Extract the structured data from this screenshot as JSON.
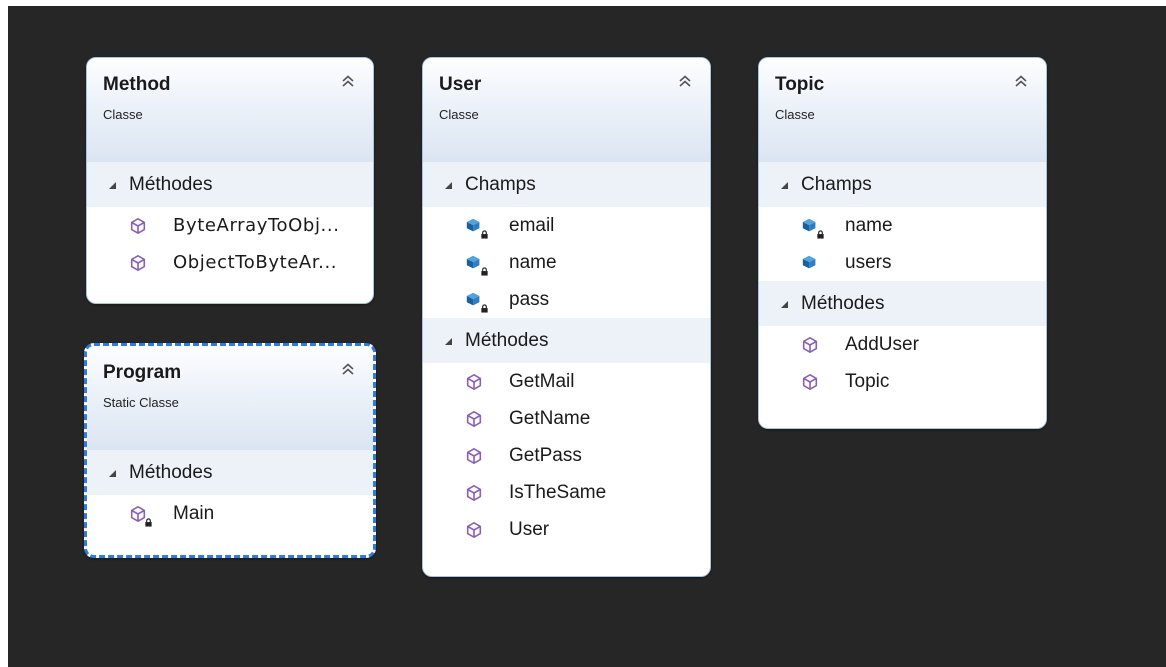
{
  "colors": {
    "canvas": "#262626",
    "header_gradient_bottom": "#dbe5f2",
    "section_bg": "#edf2f9",
    "selection": "#2f7be0",
    "method_icon": "#8b5fb5",
    "field_icon": "#1f73b8"
  },
  "classes": {
    "method": {
      "name": "Method",
      "kind": "Classe",
      "sections": {
        "methods": {
          "label": "Méthodes",
          "items": [
            "ByteArrayToObj...",
            "ObjectToByteAr..."
          ]
        }
      }
    },
    "program": {
      "name": "Program",
      "kind": "Static Classe",
      "sections": {
        "methods": {
          "label": "Méthodes",
          "items": [
            "Main"
          ]
        }
      }
    },
    "user": {
      "name": "User",
      "kind": "Classe",
      "sections": {
        "fields": {
          "label": "Champs",
          "items": [
            "email",
            "name",
            "pass"
          ]
        },
        "methods": {
          "label": "Méthodes",
          "items": [
            "GetMail",
            "GetName",
            "GetPass",
            "IsTheSame",
            "User"
          ]
        }
      }
    },
    "topic": {
      "name": "Topic",
      "kind": "Classe",
      "sections": {
        "fields": {
          "label": "Champs",
          "items": [
            "name",
            "users"
          ]
        },
        "methods": {
          "label": "Méthodes",
          "items": [
            "AddUser",
            "Topic"
          ]
        }
      }
    }
  },
  "icons": {
    "collapse": "double-chevron-up-icon",
    "section_toggle": "expanded-triangle-icon",
    "public_method": "method-cube-icon",
    "private_method": "private-method-cube-icon",
    "private_field": "private-field-icon",
    "public_field": "field-icon"
  }
}
